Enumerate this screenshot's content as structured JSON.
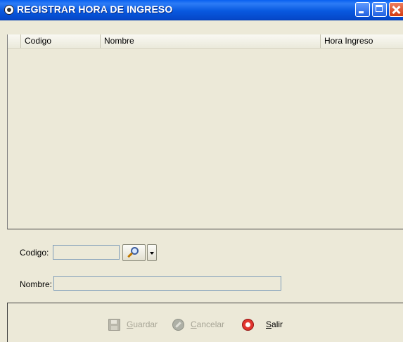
{
  "window": {
    "title": "REGISTRAR HORA DE INGRESO"
  },
  "table": {
    "columns": [
      "Codigo",
      "Nombre",
      "Hora Ingreso"
    ],
    "rows": []
  },
  "form": {
    "codigo_label": "Codigo:",
    "codigo_value": "",
    "nombre_label": "Nombre:",
    "nombre_value": ""
  },
  "toolbar": {
    "guardar": {
      "label_first": "G",
      "label_rest": "uardar",
      "enabled": false,
      "icon": "floppy-disk-icon"
    },
    "cancelar": {
      "label_first": "C",
      "label_rest": "ancelar",
      "enabled": false,
      "icon": "cancel-icon"
    },
    "salir": {
      "label_first": "S",
      "label_rest": "alir",
      "enabled": true,
      "icon": "exit-icon"
    }
  },
  "colors": {
    "titlebar": "#0a5fe8",
    "window_bg": "#ece9d8",
    "disabled_text": "#a7a596"
  }
}
